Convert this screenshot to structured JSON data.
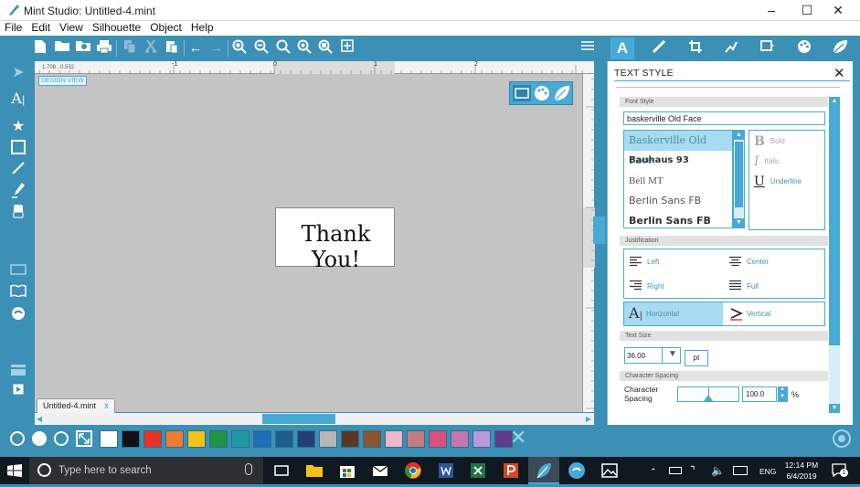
{
  "window": {
    "title": "Mint Studio: Untitled-4.mint"
  },
  "menu": [
    "File",
    "Edit",
    "View",
    "Silhouette",
    "Object",
    "Help"
  ],
  "canvas": {
    "design_view_label": "DESIGN VIEW",
    "coords": "1.708 , 0.532",
    "ruler_h_labels": [
      "-1",
      "0",
      "1",
      "2"
    ],
    "page_text": "Thank You!",
    "tab_label": "Untitled-4.mint",
    "tab_close": "x"
  },
  "panel": {
    "title": "TEXT STYLE",
    "font_style_header": "Font Style",
    "font_input": "baskerville Old Face",
    "fonts": [
      "Baskerville Old Face",
      "Bauhaus 93",
      "Bell MT",
      "Berlin Sans FB",
      "Berlin Sans FB Demi"
    ],
    "styles": {
      "bold": "Bold",
      "italic": "Italic",
      "underline": "Underline"
    },
    "justification_header": "Justification",
    "justification": {
      "left": "Left",
      "center": "Center",
      "right": "Right",
      "full": "Full"
    },
    "orientation": {
      "horizontal": "Horizontal",
      "vertical": "Vertical"
    },
    "text_size_header": "Text Size",
    "text_size_value": "36.00",
    "text_size_unit": "pt",
    "char_spacing_header": "Character Spacing",
    "char_spacing_label": "Character Spacing",
    "char_spacing_value": "100.0",
    "char_spacing_unit": "%"
  },
  "palette": [
    "#ffffff",
    "#111111",
    "#e63323",
    "#f07a30",
    "#f2c215",
    "#1f9445",
    "#1e9aa4",
    "#1f6fb8",
    "#215d8a",
    "#243f73",
    "#b6b6b6",
    "#5a3826",
    "#8a5530",
    "#f2b6c6",
    "#c87a82",
    "#d9507a",
    "#c774b0",
    "#b79ad8",
    "#5f3b8a"
  ],
  "accent": "#3c90b5",
  "highlight": "#49a9d6",
  "taskbar": {
    "search_placeholder": "Type here to search",
    "lang": "ENG",
    "time": "12:14 PM",
    "date": "6/4/2019",
    "notifications": "1"
  }
}
